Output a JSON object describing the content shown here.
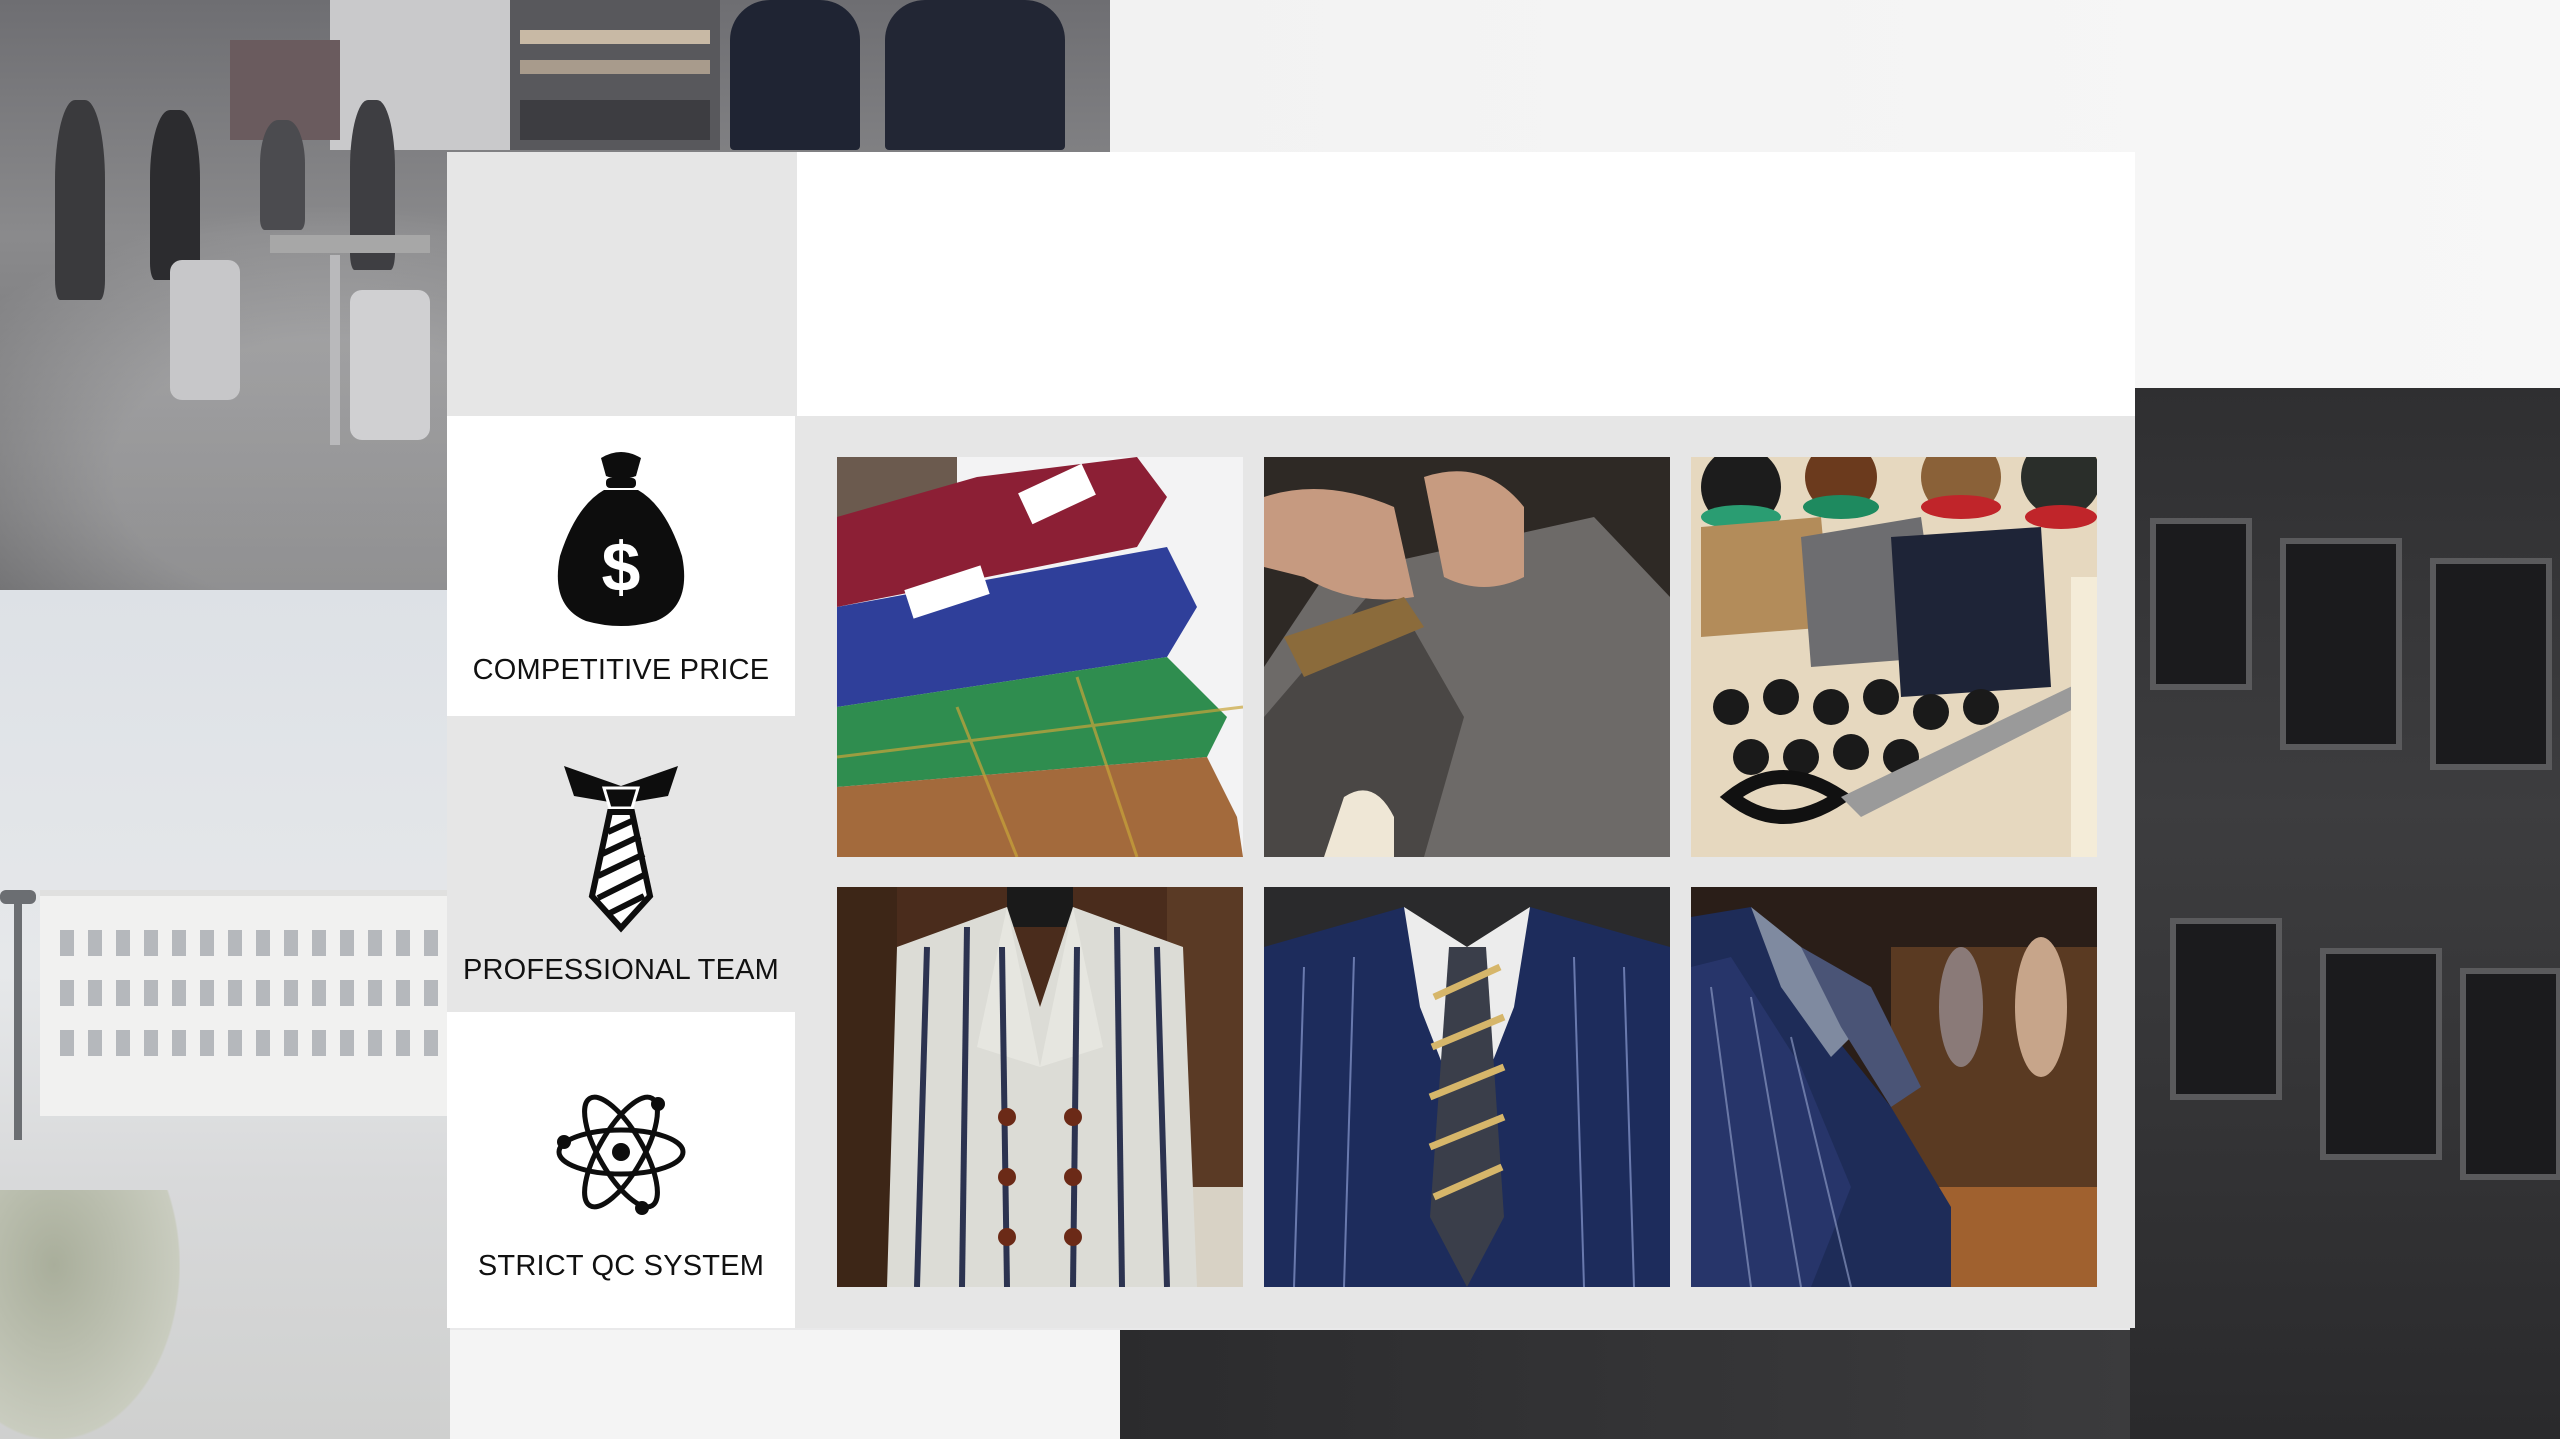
{
  "features": [
    {
      "label": "COMPETITIVE PRICE",
      "icon": "money-bag-icon"
    },
    {
      "label": "PROFESSIONAL TEAM",
      "icon": "tie-icon"
    },
    {
      "label": "STRICT QC SYSTEM",
      "icon": "atom-icon"
    }
  ],
  "photos": [
    {
      "name": "fabric-swatches-photo"
    },
    {
      "name": "tailor-hands-photo"
    },
    {
      "name": "fabric-buttons-scissors-photo"
    },
    {
      "name": "striped-jacket-mannequin-photo"
    },
    {
      "name": "navy-suit-tie-photo"
    },
    {
      "name": "suit-rack-photo"
    }
  ],
  "colors": {
    "card_bg": "#e6e6e6",
    "header_bg": "#ffffff",
    "icon": "#0d0d0d"
  }
}
